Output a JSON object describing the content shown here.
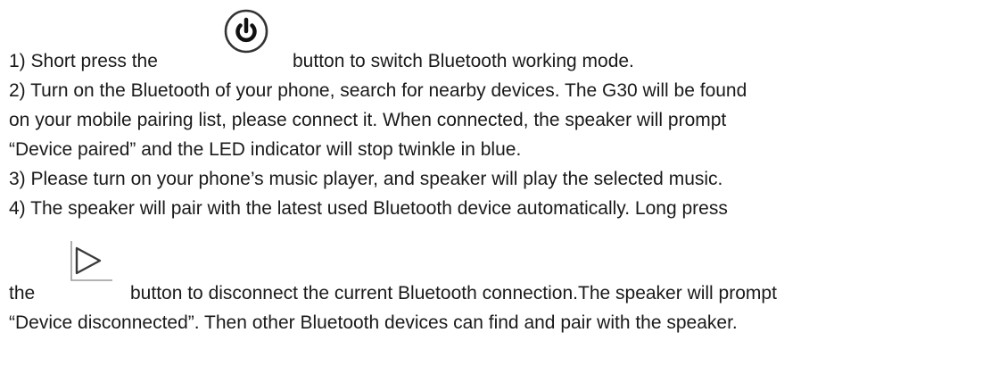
{
  "instructions": {
    "step1": {
      "before_icon": "1) Short press the",
      "icon": "power-icon",
      "after_icon": "button to switch Bluetooth working mode."
    },
    "step2": {
      "lines": [
        "2) Turn on the Bluetooth of your phone, search for nearby devices. The G30 will be found",
        "on your mobile pairing list, please connect it. When connected, the speaker will prompt",
        "“Device paired” and the LED indicator will stop twinkle in blue."
      ]
    },
    "step3": {
      "text": "3) Please turn on your phone’s music player, and speaker will play the selected music."
    },
    "step4": {
      "line1": "4) The speaker will pair with the latest used Bluetooth device automatically. Long press",
      "before_icon": "the",
      "icon": "play-icon",
      "after_icon": "button to disconnect the current Bluetooth connection.The speaker will prompt",
      "line3": "“Device disconnected”. Then other Bluetooth devices can find and pair with the speaker."
    }
  }
}
